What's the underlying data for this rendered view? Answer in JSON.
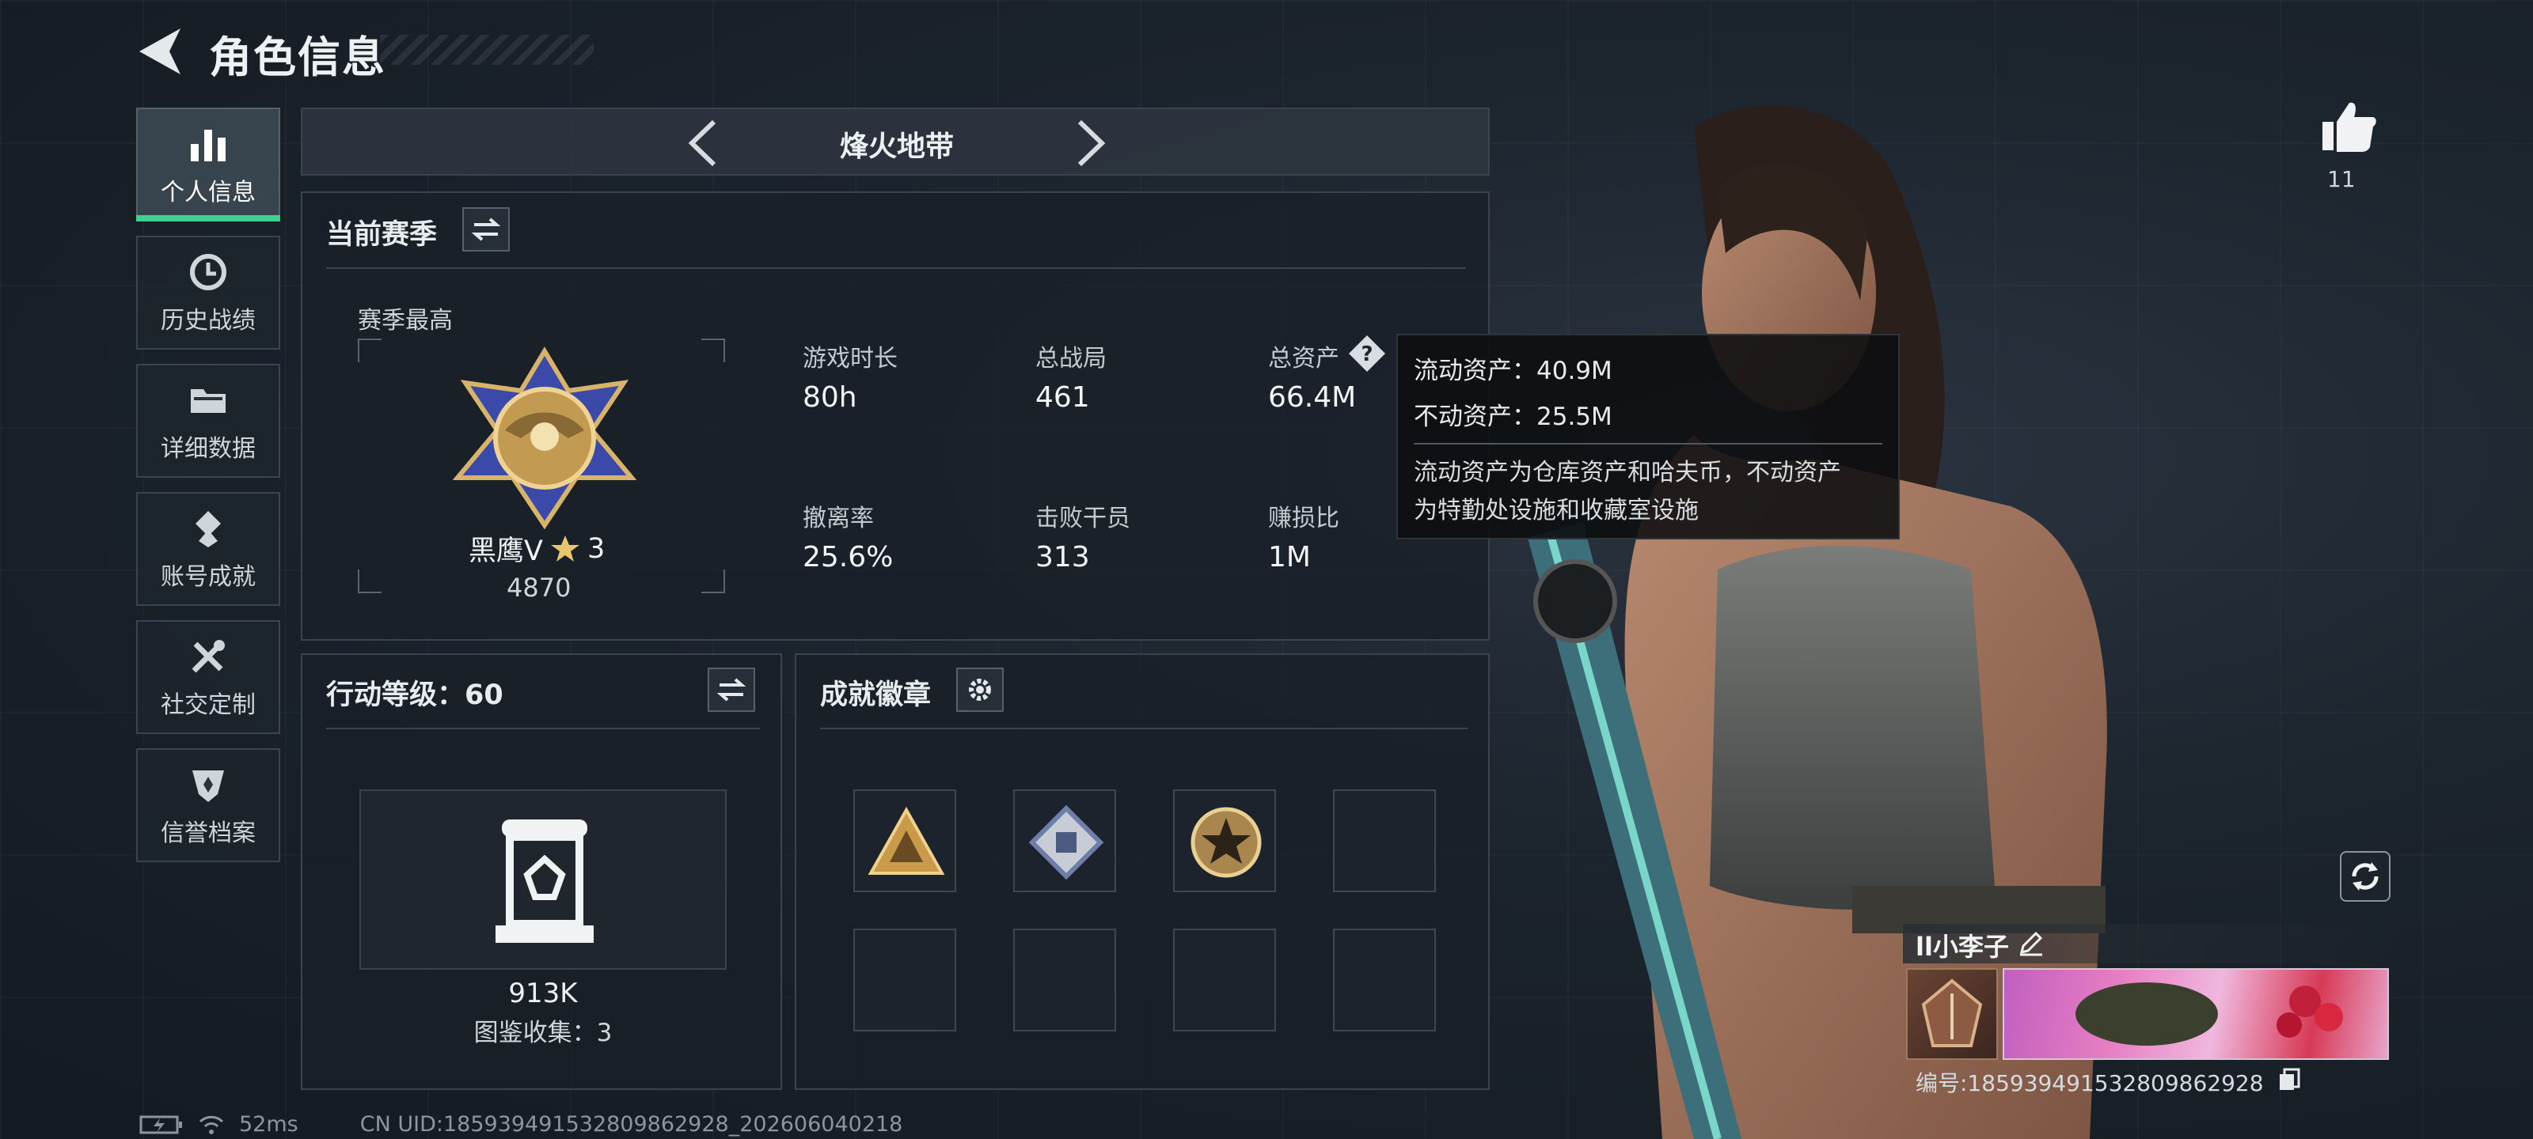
{
  "header": {
    "title": "角色信息",
    "back_icon": "back-arrow-icon"
  },
  "tabs": [
    {
      "label": "个人信息",
      "icon": "bar-chart-icon",
      "active": true
    },
    {
      "label": "历史战绩",
      "icon": "history-icon",
      "active": false
    },
    {
      "label": "详细数据",
      "icon": "folder-icon",
      "active": false
    },
    {
      "label": "账号成就",
      "icon": "achievement-icon",
      "active": false
    },
    {
      "label": "社交定制",
      "icon": "tools-icon",
      "active": false
    },
    {
      "label": "信誉档案",
      "icon": "shield-icon",
      "active": false
    }
  ],
  "mode": {
    "title": "烽火地带"
  },
  "season": {
    "title": "当前赛季",
    "best_label": "赛季最高",
    "rank_name": "黑鹰V",
    "rank_stars": "3",
    "rank_score": "4870",
    "stats": [
      {
        "label": "游戏时长",
        "value": "80h"
      },
      {
        "label": "总战局",
        "value": "461"
      },
      {
        "label": "总资产",
        "value": "66.4M"
      },
      {
        "label": "撤离率",
        "value": "25.6%"
      },
      {
        "label": "击败干员",
        "value": "313"
      },
      {
        "label": "赚损比",
        "value": "1M"
      }
    ]
  },
  "tooltip": {
    "liquid": "流动资产：40.9M",
    "fixed": "不动资产：25.5M",
    "desc_line1": "流动资产为仓库资产和哈夫币，不动资产",
    "desc_line2": "为特勤处设施和收藏室设施"
  },
  "action_level": {
    "title": "行动等级：60",
    "value": "913K",
    "collection": "图鉴收集：3"
  },
  "badges": {
    "title": "成就徽章",
    "filled_slots": 3,
    "total_slots": 8
  },
  "profile": {
    "likes": "11",
    "nickname": "ll小李子",
    "player_id": "编号:1859394915328098629​28"
  },
  "status": {
    "ping": "52ms",
    "uid": "CN UID:185939491532809862928_202606040218"
  },
  "colors": {
    "accent": "#3fd18f",
    "rank_star": "#e8c76a"
  }
}
